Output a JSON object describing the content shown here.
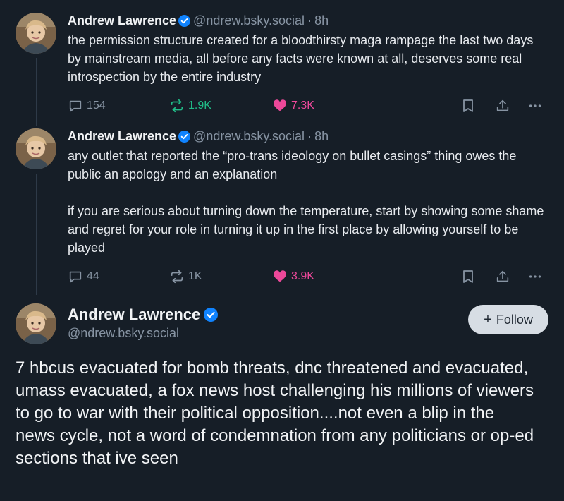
{
  "posts": [
    {
      "author": "Andrew Lawrence",
      "handle": "@ndrew.bsky.social",
      "time": "8h",
      "text": "the permission structure created for a bloodthirsty maga rampage the last two days by mainstream media, all before any facts were known at all, deserves some real introspection by the entire industry",
      "replies": "154",
      "reposts": "1.9K",
      "likes": "7.3K",
      "reposted": true,
      "liked": true
    },
    {
      "author": "Andrew Lawrence",
      "handle": "@ndrew.bsky.social",
      "time": "8h",
      "text": "any outlet that reported the “pro-trans ideology on bullet casings” thing owes the public an apology and an explanation\n\nif you are serious about turning down the temperature, start by showing some shame and regret for your role in turning it up in the first place by allowing yourself to be played",
      "replies": "44",
      "reposts": "1K",
      "likes": "3.9K",
      "reposted": false,
      "liked": true
    }
  ],
  "main_post": {
    "author": "Andrew Lawrence",
    "handle": "@ndrew.bsky.social",
    "follow_label": "Follow",
    "text": "7 hbcus evacuated for bomb threats, dnc threatened and evacuated, umass evacuated, a fox news host challenging his millions of viewers to go to war with their political opposition....not even a blip in the news cycle, not a word of condemnation from any politicians or op-ed sections that ive seen"
  },
  "colors": {
    "background": "#161e27",
    "verified": "#1083fe",
    "repost_active": "#20bc87",
    "like_active": "#ec4899",
    "muted": "#8794a3"
  },
  "icons": [
    "verified-icon",
    "reply-icon",
    "repost-icon",
    "like-icon",
    "bookmark-icon",
    "share-icon",
    "more-icon",
    "plus-icon"
  ]
}
